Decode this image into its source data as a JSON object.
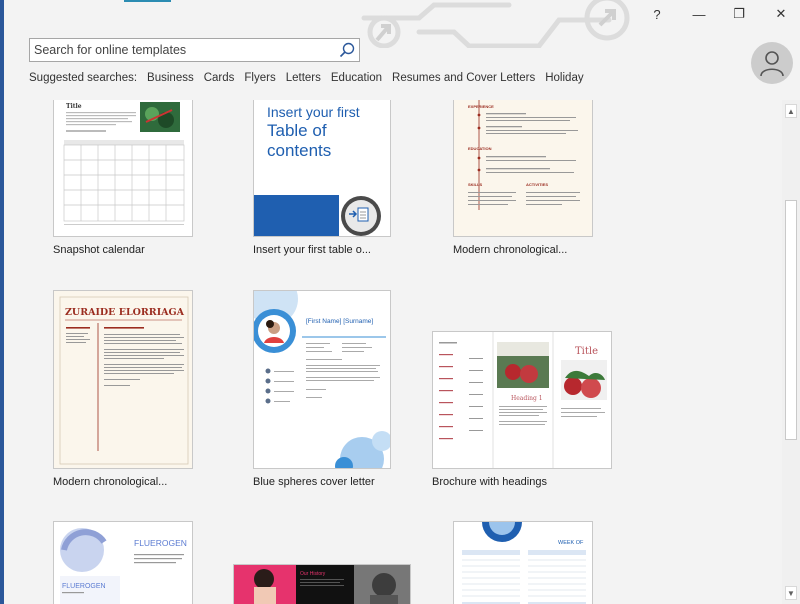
{
  "window": {
    "help": "?",
    "minimize": "—",
    "restore": "❐",
    "close": "✕"
  },
  "search": {
    "placeholder": "Search for online templates"
  },
  "suggested": {
    "label": "Suggested searches:",
    "items": [
      "Business",
      "Cards",
      "Flyers",
      "Letters",
      "Education",
      "Resumes and Cover Letters",
      "Holiday"
    ]
  },
  "templates": [
    {
      "caption": "Snapshot calendar",
      "thumb_title": "Title"
    },
    {
      "caption": "Insert your first table o...",
      "thumb_title": "Insert your first Table of contents"
    },
    {
      "caption": "Modern chronological...",
      "thumb_title": "EXPERIENCE"
    },
    {
      "caption": "Modern chronological...",
      "thumb_title": "ZURAIDE ELORRIAGA"
    },
    {
      "caption": "Blue spheres cover letter",
      "thumb_title": "[First Name] [Surname]"
    },
    {
      "caption": "Brochure with headings",
      "thumb_title": "Heading 1"
    },
    {
      "caption": "",
      "thumb_title": "FLUEROGEN"
    },
    {
      "caption": "",
      "thumb_title": "Our History"
    },
    {
      "caption": "",
      "thumb_title": "WEEK OF"
    }
  ],
  "colors": {
    "accent": "#2b579a",
    "toc_blue": "#1f5fb0",
    "resume_red": "#9b2d20",
    "sphere_blue": "#3a8fd6"
  }
}
